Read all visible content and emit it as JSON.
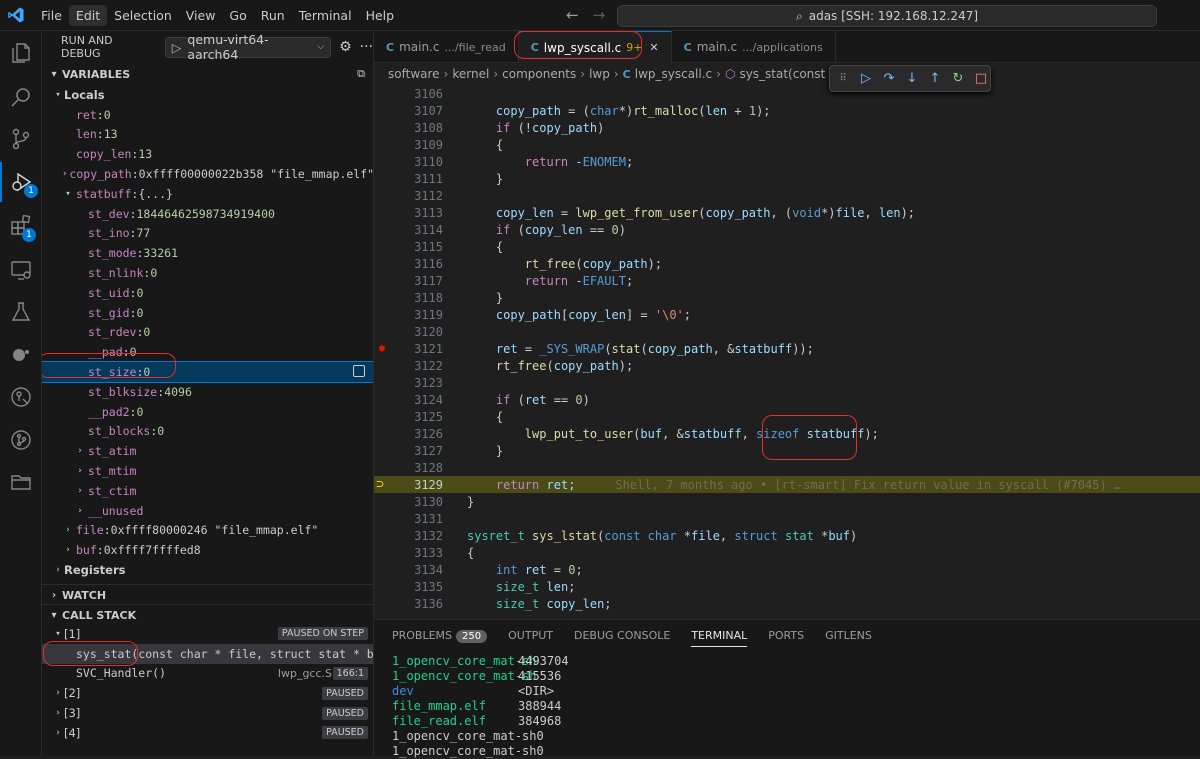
{
  "menu": [
    "File",
    "Edit",
    "Selection",
    "View",
    "Go",
    "Run",
    "Terminal",
    "Help"
  ],
  "menu_active": "Edit",
  "command_center": "adas [SSH: 192.168.12.247]",
  "activity_badges": {
    "debug": "1",
    "extensions": "1"
  },
  "sidebar": {
    "title": "RUN AND DEBUG",
    "config": "qemu-virt64-aarch64",
    "variables_header": "VARIABLES",
    "locals_label": "Locals",
    "registers_label": "Registers",
    "variables": [
      {
        "name": "ret",
        "value": "0"
      },
      {
        "name": "len",
        "value": "13"
      },
      {
        "name": "copy_len",
        "value": "13"
      },
      {
        "name": "copy_path",
        "value": "0xffff00000022b358 \"file_mmap.elf\""
      },
      {
        "name": "statbuff",
        "value": "{...}"
      },
      {
        "name": "st_dev",
        "value": "18446462598734919400"
      },
      {
        "name": "st_ino",
        "value": "77"
      },
      {
        "name": "st_mode",
        "value": "33261"
      },
      {
        "name": "st_nlink",
        "value": "0"
      },
      {
        "name": "st_uid",
        "value": "0"
      },
      {
        "name": "st_gid",
        "value": "0"
      },
      {
        "name": "st_rdev",
        "value": "0"
      },
      {
        "name": "__pad",
        "value": "0"
      },
      {
        "name": "st_size",
        "value": "0"
      },
      {
        "name": "st_blksize",
        "value": "4096"
      },
      {
        "name": "__pad2",
        "value": "0"
      },
      {
        "name": "st_blocks",
        "value": "0"
      },
      {
        "name": "st_atim",
        "value": ""
      },
      {
        "name": "st_mtim",
        "value": ""
      },
      {
        "name": "st_ctim",
        "value": ""
      },
      {
        "name": "__unused",
        "value": ""
      },
      {
        "name": "file",
        "value": "0xffff80000246 \"file_mmap.elf\""
      },
      {
        "name": "buf",
        "value": "0xffff7ffffed8"
      }
    ],
    "watch_header": "WATCH",
    "callstack_header": "CALL STACK",
    "threads": [
      {
        "label": "[1]",
        "status": "PAUSED ON STEP"
      },
      {
        "label": "[2]",
        "status": "PAUSED"
      },
      {
        "label": "[3]",
        "status": "PAUSED"
      },
      {
        "label": "[4]",
        "status": "PAUSED"
      }
    ],
    "frames": [
      {
        "name": "sys_stat(const char * file, struct stat * buf)",
        "file": "",
        "pos": ""
      },
      {
        "name": "SVC_Handler()",
        "file": "lwp_gcc.S",
        "pos": "166:1"
      }
    ]
  },
  "tabs": [
    {
      "label": "main.c",
      "desc": ".../file_read",
      "mod": ""
    },
    {
      "label": "lwp_syscall.c",
      "desc": "",
      "mod": "9+"
    },
    {
      "label": "main.c",
      "desc": ".../applications",
      "mod": ""
    }
  ],
  "breadcrumb": [
    "software",
    "kernel",
    "components",
    "lwp",
    "lwp_syscall.c",
    "sys_stat(const char *, s"
  ],
  "code_lines": [
    {
      "n": "3106",
      "html": ""
    },
    {
      "n": "3107",
      "html": "    <span class='v'>copy_path</span> = (<span class='k'>char</span>*)<span class='f'>rt_malloc</span>(<span class='v'>len</span> + <span class='n'>1</span>);"
    },
    {
      "n": "3108",
      "html": "    <span class='kc'>if</span> (!<span class='v'>copy_path</span>)"
    },
    {
      "n": "3109",
      "html": "    {"
    },
    {
      "n": "3110",
      "html": "        <span class='kc'>return</span> -<span class='k'>ENOMEM</span>;"
    },
    {
      "n": "3111",
      "html": "    }"
    },
    {
      "n": "3112",
      "html": ""
    },
    {
      "n": "3113",
      "html": "    <span class='v'>copy_len</span> = <span class='f'>lwp_get_from_user</span>(<span class='v'>copy_path</span>, (<span class='k'>void</span>*)<span class='v'>file</span>, <span class='v'>len</span>);"
    },
    {
      "n": "3114",
      "html": "    <span class='kc'>if</span> (<span class='v'>copy_len</span> == <span class='n'>0</span>)"
    },
    {
      "n": "3115",
      "html": "    {"
    },
    {
      "n": "3116",
      "html": "        <span class='f'>rt_free</span>(<span class='v'>copy_path</span>);"
    },
    {
      "n": "3117",
      "html": "        <span class='kc'>return</span> -<span class='k'>EFAULT</span>;"
    },
    {
      "n": "3118",
      "html": "    }"
    },
    {
      "n": "3119",
      "html": "    <span class='v'>copy_path</span>[<span class='v'>copy_len</span>] = <span class='s'>'\\0'</span>;"
    },
    {
      "n": "3120",
      "html": ""
    },
    {
      "n": "3121",
      "html": "    <span class='v'>ret</span> = <span class='k'>_SYS_WRAP</span>(<span class='f'>stat</span>(<span class='v'>copy_path</span>, &amp;<span class='v'>statbuff</span>));"
    },
    {
      "n": "3122",
      "html": "    <span class='f'>rt_free</span>(<span class='v'>copy_path</span>);"
    },
    {
      "n": "3123",
      "html": ""
    },
    {
      "n": "3124",
      "html": "    <span class='kc'>if</span> (<span class='v'>ret</span> == <span class='n'>0</span>)"
    },
    {
      "n": "3125",
      "html": "    {"
    },
    {
      "n": "3126",
      "html": "        <span class='f'>lwp_put_to_user</span>(<span class='v'>buf</span>, &amp;<span class='v'>statbuff</span>, <span class='k'>sizeof</span> <span class='v'>statbuff</span>);"
    },
    {
      "n": "3127",
      "html": "    }"
    },
    {
      "n": "3128",
      "html": ""
    },
    {
      "n": "3129",
      "html": "    <span class='kc'>return</span> <span class='v'>ret</span>;<span class='blame'>Shell, 7 months ago • [rt-smart] Fix return value in syscall (#7045) …</span>"
    },
    {
      "n": "3130",
      "html": "}"
    },
    {
      "n": "3131",
      "html": ""
    },
    {
      "n": "3132",
      "html": "<span class='t'>sysret_t</span> <span class='f'>sys_lstat</span>(<span class='k'>const</span> <span class='k'>char</span> *<span class='v'>file</span>, <span class='k'>struct</span> <span class='t'>stat</span> *<span class='v'>buf</span>)"
    },
    {
      "n": "3133",
      "html": "{"
    },
    {
      "n": "3134",
      "html": "    <span class='k'>int</span> <span class='v'>ret</span> = <span class='n'>0</span>;"
    },
    {
      "n": "3135",
      "html": "    <span class='t'>size_t</span> <span class='v'>len</span>;"
    },
    {
      "n": "3136",
      "html": "    <span class='t'>size_t</span> <span class='v'>copy_len</span>;"
    }
  ],
  "panel_tabs": [
    "PROBLEMS",
    "OUTPUT",
    "DEBUG CONSOLE",
    "TERMINAL",
    "PORTS",
    "GITLENS"
  ],
  "problems_count": "250",
  "terminal": [
    {
      "name": "1_opencv_core_mat-sh",
      "size": "4493704",
      "kind": "exe"
    },
    {
      "name": "1_opencv_core_mat-sh",
      "size": "415536",
      "kind": "exe"
    },
    {
      "name": "dev",
      "size": "<DIR>",
      "kind": "dir"
    },
    {
      "name": "file_mmap.elf",
      "size": "388944",
      "kind": "exe"
    },
    {
      "name": "file_read.elf",
      "size": "384968",
      "kind": "exe"
    },
    {
      "name": "1_opencv_core_mat-sh0",
      "size": "",
      "kind": "plain"
    },
    {
      "name": "1_opencv_core_mat-sh0",
      "size": "",
      "kind": "plain"
    }
  ]
}
